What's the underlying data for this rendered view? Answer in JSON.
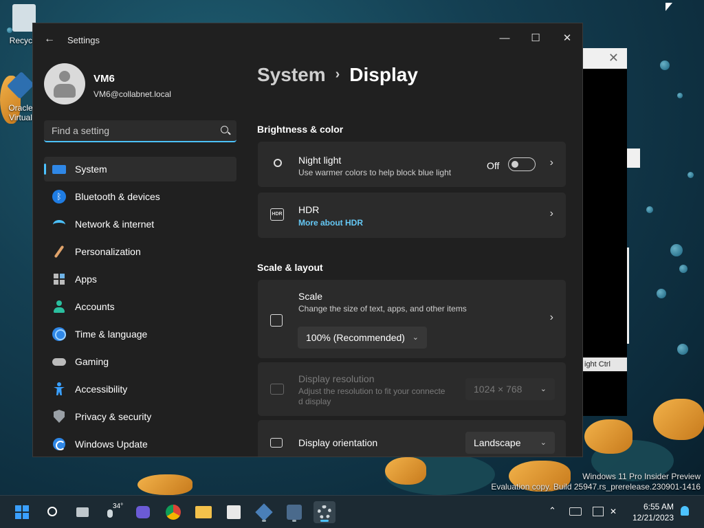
{
  "desktop": {
    "icons": [
      {
        "label": "Recycle"
      },
      {
        "label": "Oracle Virtual"
      }
    ]
  },
  "background_window": {
    "close_glyph": "✕",
    "status_text": "ight Ctrl"
  },
  "window": {
    "title": "Settings",
    "back_glyph": "←",
    "minimize_glyph": "—",
    "maximize_glyph": "☐",
    "close_glyph": "✕"
  },
  "profile": {
    "name": "VM6",
    "email": "VM6@collabnet.local"
  },
  "search": {
    "placeholder": "Find a setting"
  },
  "nav": {
    "items": [
      {
        "label": "System",
        "icon": "system-icon"
      },
      {
        "label": "Bluetooth & devices",
        "icon": "bluetooth-icon"
      },
      {
        "label": "Network & internet",
        "icon": "wifi-icon"
      },
      {
        "label": "Personalization",
        "icon": "brush-icon"
      },
      {
        "label": "Apps",
        "icon": "apps-icon"
      },
      {
        "label": "Accounts",
        "icon": "person-icon"
      },
      {
        "label": "Time & language",
        "icon": "globe-clock-icon"
      },
      {
        "label": "Gaming",
        "icon": "gamepad-icon"
      },
      {
        "label": "Accessibility",
        "icon": "accessibility-icon"
      },
      {
        "label": "Privacy & security",
        "icon": "shield-icon"
      },
      {
        "label": "Windows Update",
        "icon": "update-icon"
      }
    ],
    "active": "System"
  },
  "breadcrumb": {
    "parent": "System",
    "separator": "›",
    "current": "Display"
  },
  "sections": {
    "brightness": "Brightness & color",
    "scale_layout": "Scale & layout"
  },
  "night_light": {
    "title": "Night light",
    "subtitle": "Use warmer colors to help block blue light",
    "state": "Off"
  },
  "hdr": {
    "title": "HDR",
    "icon_text": "HDR",
    "link": "More about HDR"
  },
  "scale": {
    "title": "Scale",
    "subtitle": "Change the size of text, apps, and other items",
    "value": "100% (Recommended)"
  },
  "resolution": {
    "title": "Display resolution",
    "subtitle_line1": "Adjust the resolution to fit your connecte",
    "subtitle_line2": "d display",
    "value": "1024 × 768"
  },
  "orientation": {
    "title": "Display orientation",
    "value": "Landscape"
  },
  "chevron": "›",
  "dropdown_glyph": "⌄",
  "watermark": {
    "line1": "Windows 11 Pro Insider Preview",
    "line2": "Evaluation copy. Build 25947.rs_prerelease.230901-1416"
  },
  "taskbar": {
    "weather_temp": "34°",
    "time": "6:55 AM",
    "date": "12/21/2023",
    "apps": [
      "start-icon",
      "search-icon",
      "task-view-icon",
      "weather-icon",
      "meet-icon",
      "chrome-icon",
      "file-explorer-icon",
      "store-icon",
      "virtualbox-icon",
      "app-icon",
      "settings-icon"
    ]
  }
}
